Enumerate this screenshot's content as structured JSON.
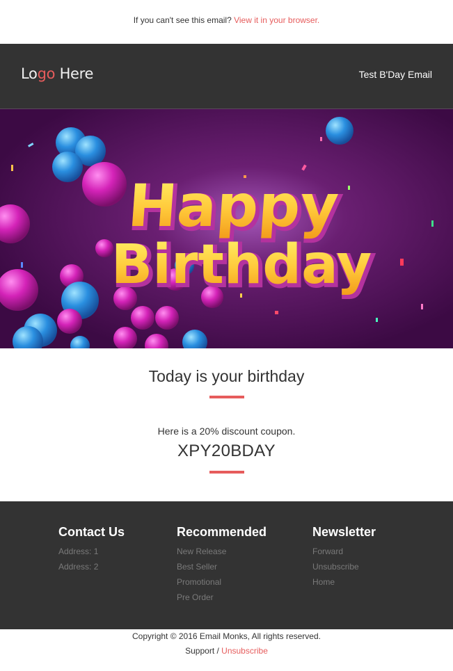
{
  "preheader": {
    "text": "If you can't see this email?",
    "link_label": "View it in your browser."
  },
  "header": {
    "logo_part1": "Lo",
    "logo_accent": "go",
    "logo_part2": " Here",
    "title": "Test B'Day Email"
  },
  "hero": {
    "line1": "Happy",
    "line2": "Birthday",
    "icon": "happy-birthday-banner-image"
  },
  "main": {
    "heading": "Today is your birthday",
    "subtext": "Here is a 20% discount coupon.",
    "coupon_code": "XPY20BDAY"
  },
  "footer": {
    "columns": [
      {
        "title": "Contact Us",
        "items": [
          "Address: 1",
          "Address: 2"
        ]
      },
      {
        "title": "Recommended",
        "items": [
          "New Release",
          "Best Seller",
          "Promotional",
          "Pre Order"
        ]
      },
      {
        "title": "Newsletter",
        "items": [
          "Forward",
          "Unsubscribe",
          "Home"
        ]
      }
    ],
    "copyright": "Copyright © 2016 Email Monks, All rights reserved.",
    "support_label": "Support",
    "separator": " / ",
    "unsubscribe_label": "Unsubscribe"
  },
  "colors": {
    "accent": "#e65c5c",
    "dark_band": "#333333",
    "hero_bg": "#4a0d4e",
    "hero_text": "#ffd43a"
  }
}
